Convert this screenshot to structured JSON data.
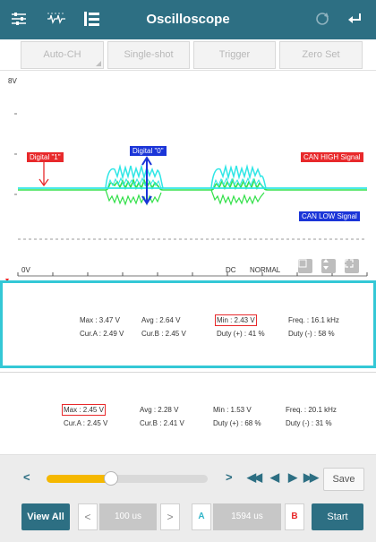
{
  "header": {
    "title": "Oscilloscope",
    "icons": [
      "sliders-icon",
      "waveform-icon",
      "layout-icon",
      "refresh-icon",
      "back-icon"
    ],
    "bg_color": "#2d6f83"
  },
  "mode_buttons": [
    {
      "label": "Auto-CH"
    },
    {
      "label": "Single-shot"
    },
    {
      "label": "Trigger"
    },
    {
      "label": "Zero Set"
    }
  ],
  "scope": {
    "top_axis_label": "8V",
    "bottom_axis_label": "0V",
    "coupling": "DC",
    "trigger_mode": "NORMAL",
    "labels": {
      "digital_1": "Digital \"1\"",
      "digital_0": "Digital \"0\"",
      "can_high": "CAN HIGH Signal",
      "can_low": "CAN LOW Signal"
    },
    "colors": {
      "ch_a": "#2fe6e6",
      "ch_b": "#33e04a",
      "annotation_red": "#e8292b",
      "annotation_blue": "#1b35d8"
    }
  },
  "measurements": {
    "channel_a": {
      "max": "Max : 3.47 V",
      "avg": "Avg : 2.64 V",
      "min": "Min : 2.43 V",
      "freq": "Freq. : 16.1 kHz",
      "cur_a": "Cur.A : 2.49 V",
      "cur_b": "Cur.B : 2.45 V",
      "duty_pos": "Duty (+) : 41 %",
      "duty_neg": "Duty (-) : 58 %"
    },
    "channel_b": {
      "max": "Max : 2.45 V",
      "avg": "Avg : 2.28 V",
      "min": "Min : 1.53 V",
      "freq": "Freq. : 20.1 kHz",
      "cur_a": "Cur.A : 2.45 V",
      "cur_b": "Cur.B : 2.41 V",
      "duty_pos": "Duty (+) : 68 %",
      "duty_neg": "Duty (-) : 31 %"
    }
  },
  "slider": {
    "position_fraction": 0.4,
    "save_label": "Save",
    "controls": [
      "<",
      ">",
      "◀◀",
      "◀",
      "▶",
      "▶▶"
    ]
  },
  "bottom": {
    "view_all_label": "View All",
    "timebase": "100 us",
    "cursor_a_label": "A",
    "cursor_value": "1594 us",
    "cursor_b_label": "B",
    "start_label": "Start"
  }
}
